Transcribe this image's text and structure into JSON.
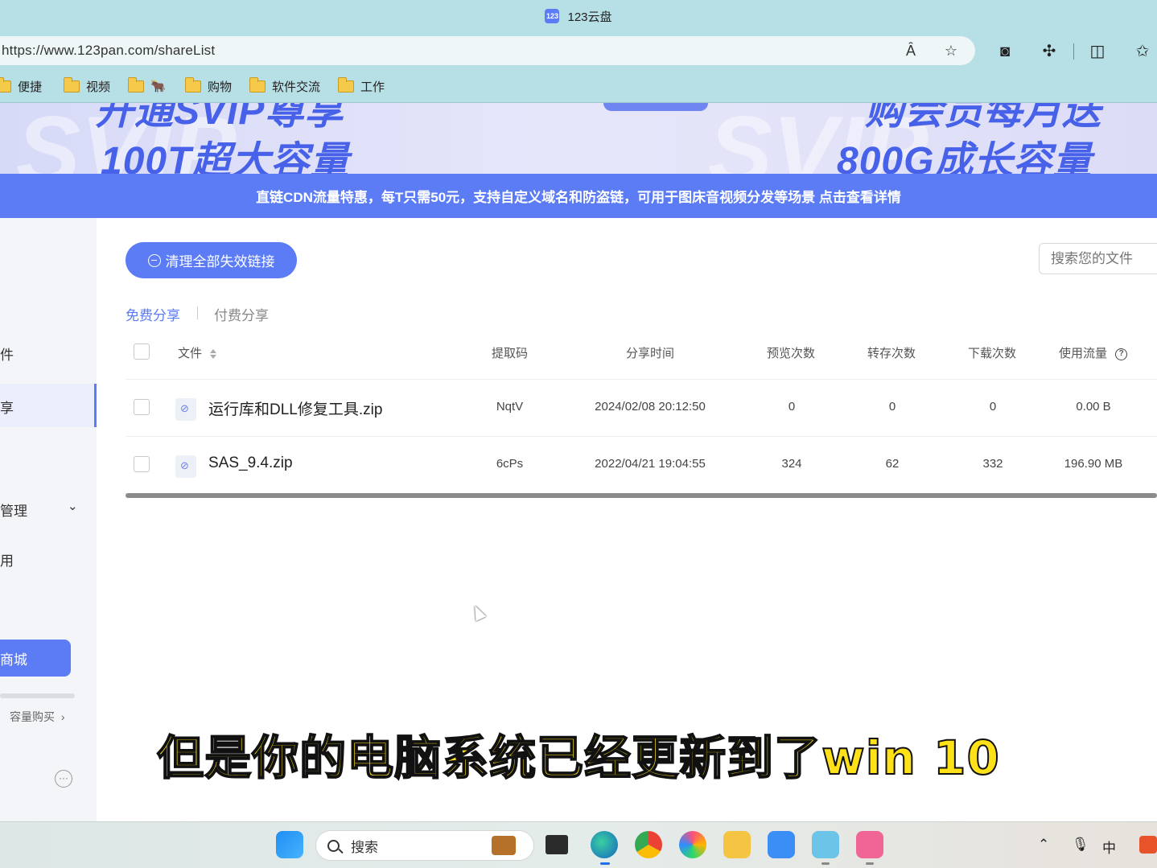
{
  "browser": {
    "tab_title": "123云盘",
    "favicon_text": "123",
    "url": "https://www.123pan.com/shareList",
    "bookmarks": [
      "便捷",
      "视频",
      "🐂",
      "购物",
      "软件交流",
      "工作"
    ]
  },
  "promo": {
    "left_line1": "开通SVIP尊享",
    "left_line2": "100T超大容量",
    "right_line1": "购会员每月送",
    "right_line2": "800G成长容量"
  },
  "notice": "直链CDN流量特惠，每T只需50元，支持自定义域名和防盗链，可用于图床音视频分发等场景 点击查看详情",
  "sidebar": {
    "item_file": "件",
    "item_share": "享",
    "item_manage": "管理",
    "item_misc": "用",
    "store_button": "商城",
    "capacity_link": "容量购买",
    "more": "···"
  },
  "main": {
    "clean_button": "清理全部失效链接",
    "search_placeholder": "搜索您的文件",
    "tabs": [
      "免费分享",
      "付费分享"
    ],
    "columns": {
      "file": "文件",
      "code": "提取码",
      "time": "分享时间",
      "views": "预览次数",
      "saves": "转存次数",
      "downloads": "下载次数",
      "traffic": "使用流量"
    },
    "rows": [
      {
        "name": "运行库和DLL修复工具.zip",
        "code": "NqtV",
        "time": "2024/02/08 20:12:50",
        "views": "0",
        "saves": "0",
        "downloads": "0",
        "traffic": "0.00 B"
      },
      {
        "name": "SAS_9.4.zip",
        "code": "6cPs",
        "time": "2022/04/21 19:04:55",
        "views": "324",
        "saves": "62",
        "downloads": "332",
        "traffic": "196.90 MB"
      }
    ]
  },
  "subtitle": "但是你的电脑系统已经更新到了win 10",
  "taskbar": {
    "search_label": "搜索",
    "ime": "中"
  },
  "colors": {
    "accent": "#5b7cf5",
    "chrome": "#b7dfe6"
  }
}
